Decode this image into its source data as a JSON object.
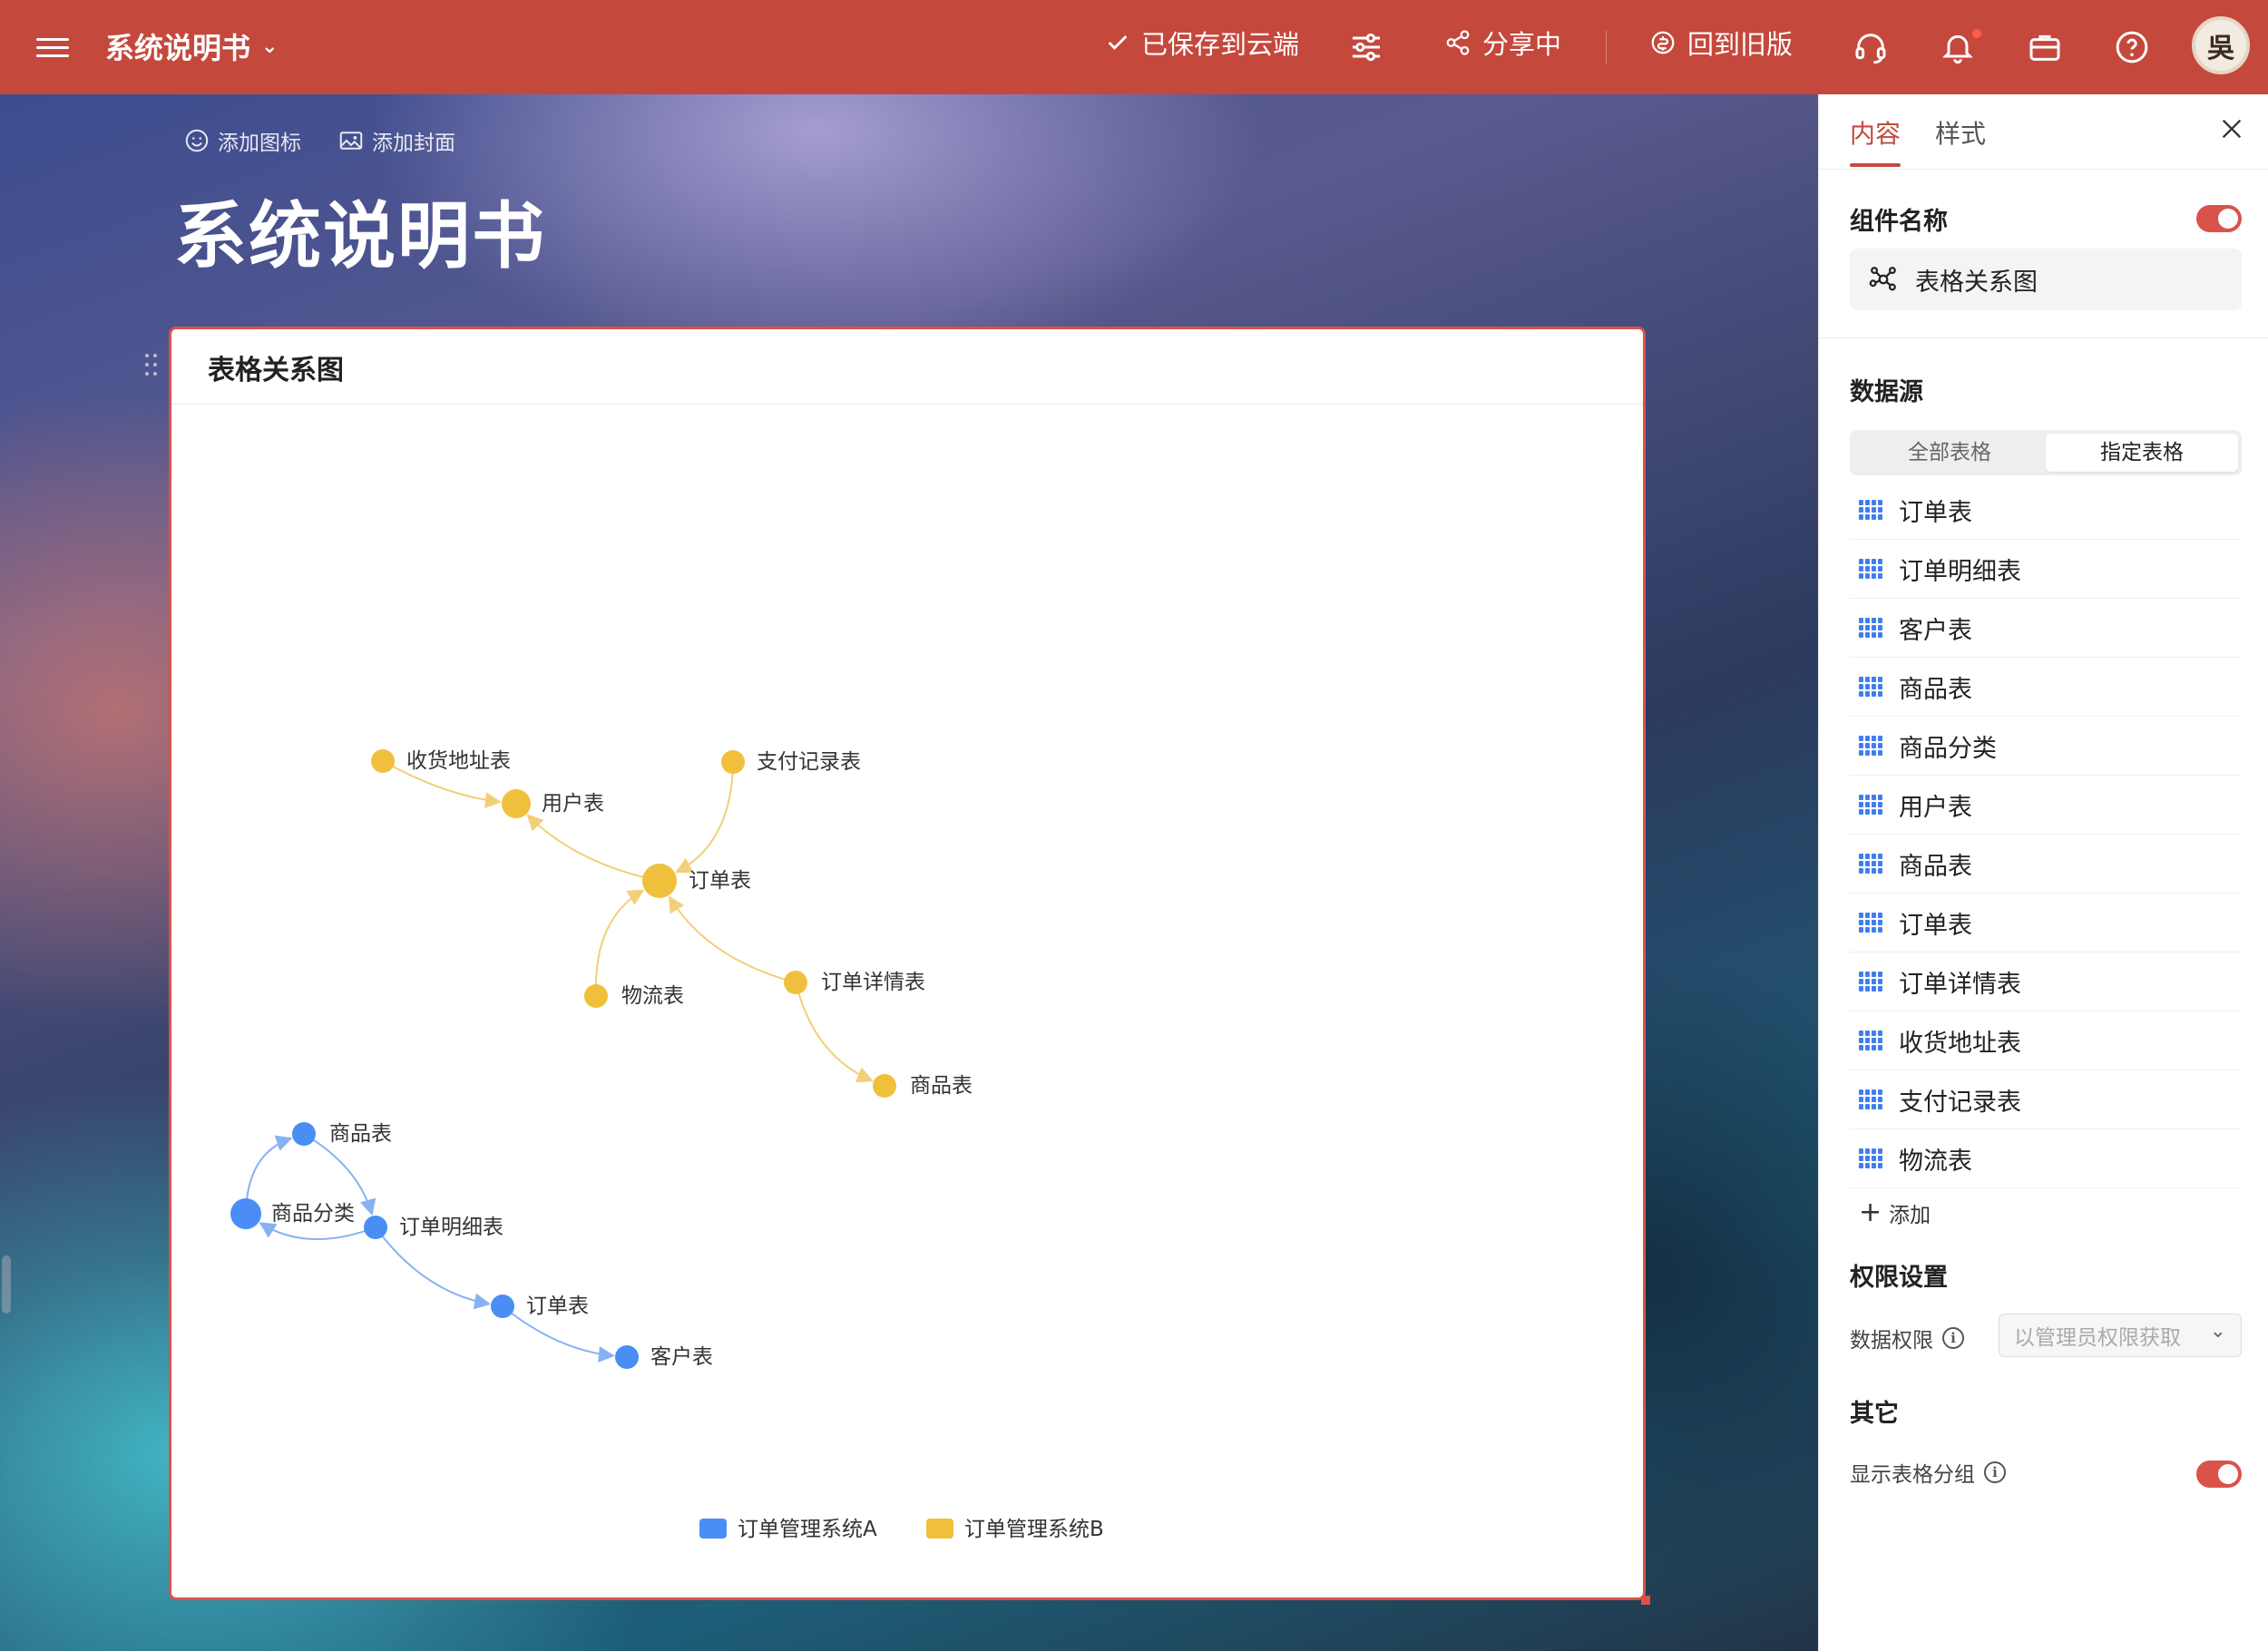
{
  "topbar": {
    "doc_title": "系统说明书",
    "saved_label": "已保存到云端",
    "share_label": "分享中",
    "revert_label": "回到旧版",
    "avatar_text": "吳",
    "bg_color": "#c5483d"
  },
  "page": {
    "add_icon_label": "添加图标",
    "add_cover_label": "添加封面",
    "title": "系统说明书"
  },
  "chart_card": {
    "title": "表格关系图"
  },
  "chart_data": {
    "type": "graph",
    "title": "表格关系图",
    "legend": [
      {
        "name": "订单管理系统A",
        "color": "#4a8ef5"
      },
      {
        "name": "订单管理系统B",
        "color": "#f0c03c"
      }
    ],
    "legend_position": "bottom-center",
    "nodes": [
      {
        "id": "a1",
        "label": "商品表",
        "group": 0
      },
      {
        "id": "a2",
        "label": "商品分类",
        "group": 0
      },
      {
        "id": "a3",
        "label": "订单明细表",
        "group": 0
      },
      {
        "id": "a4",
        "label": "订单表",
        "group": 0
      },
      {
        "id": "a5",
        "label": "客户表",
        "group": 0
      },
      {
        "id": "b1",
        "label": "收货地址表",
        "group": 1
      },
      {
        "id": "b2",
        "label": "用户表",
        "group": 1
      },
      {
        "id": "b3",
        "label": "支付记录表",
        "group": 1
      },
      {
        "id": "b4",
        "label": "订单表",
        "group": 1
      },
      {
        "id": "b5",
        "label": "物流表",
        "group": 1
      },
      {
        "id": "b6",
        "label": "订单详情表",
        "group": 1
      },
      {
        "id": "b7",
        "label": "商品表",
        "group": 1
      }
    ],
    "edges": [
      {
        "from": "a2",
        "to": "a1"
      },
      {
        "from": "a1",
        "to": "a3"
      },
      {
        "from": "a3",
        "to": "a2"
      },
      {
        "from": "a3",
        "to": "a4"
      },
      {
        "from": "a4",
        "to": "a5"
      },
      {
        "from": "b1",
        "to": "b2"
      },
      {
        "from": "b4",
        "to": "b2"
      },
      {
        "from": "b3",
        "to": "b4"
      },
      {
        "from": "b5",
        "to": "b4"
      },
      {
        "from": "b6",
        "to": "b4"
      },
      {
        "from": "b6",
        "to": "b7"
      }
    ]
  },
  "panel": {
    "tabs": [
      {
        "label": "内容",
        "active": true
      },
      {
        "label": "样式",
        "active": false
      }
    ],
    "component_name_title": "组件名称",
    "component_name_value": "表格关系图",
    "component_name_enabled": true,
    "datasource_title": "数据源",
    "datasource_options": [
      {
        "label": "全部表格",
        "selected": false
      },
      {
        "label": "指定表格",
        "selected": true
      }
    ],
    "tables": [
      "订单表",
      "订单明细表",
      "客户表",
      "商品表",
      "商品分类",
      "用户表",
      "商品表",
      "订单表",
      "订单详情表",
      "收货地址表",
      "支付记录表",
      "物流表"
    ],
    "add_label": "添加",
    "permission_title": "权限设置",
    "data_permission_label": "数据权限",
    "data_permission_placeholder": "以管理员权限获取",
    "other_title": "其它",
    "show_group_label": "显示表格分组",
    "show_group_enabled": true,
    "accent_color": "#d9534a"
  }
}
